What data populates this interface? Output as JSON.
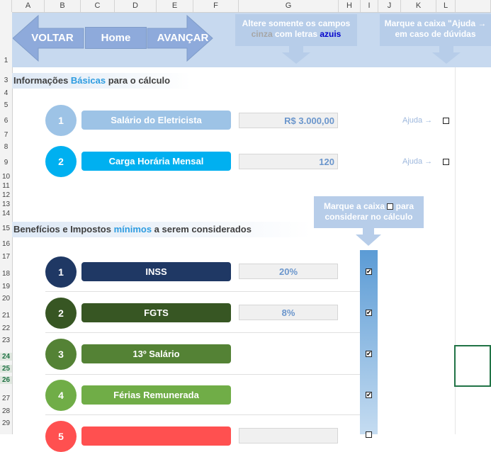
{
  "columns": [
    "A",
    "B",
    "C",
    "D",
    "E",
    "F",
    "G",
    "H",
    "I",
    "J",
    "K",
    "L"
  ],
  "rows": [
    "1",
    "3",
    "4",
    "5",
    "6",
    "7",
    "8",
    "9",
    "10",
    "11",
    "12",
    "13",
    "14",
    "15",
    "16",
    "17",
    "18",
    "19",
    "20",
    "21",
    "22",
    "23",
    "24",
    "25",
    "26",
    "27",
    "28",
    "29"
  ],
  "nav": {
    "back_label": "VOLTAR",
    "home_label": "Home",
    "next_label": "AVANÇAR"
  },
  "hints": {
    "fields_part1": "Altere somente os campos",
    "fields_gray": "cinza",
    "fields_mid": " com letras ",
    "fields_blue": "azuis",
    "help_line1": "Marque a caixa \"Ajuda →",
    "help_line2": "em caso de dúvidas",
    "consider_line1a": "Marque a caixa ",
    "consider_line1b": " para",
    "consider_line2": "considerar no cálculo"
  },
  "section1": {
    "pre": "Informações ",
    "highlight": "Básicas",
    "post": " para o cálculo"
  },
  "section2": {
    "pre": "Benefícios e Impostos ",
    "highlight": "mínimos",
    "post": " a serem considerados"
  },
  "basic_items": [
    {
      "num": "1",
      "label": "Salário do Eletricista",
      "value": "R$ 3.000,00",
      "help": "Ajuda →",
      "checked": false
    },
    {
      "num": "2",
      "label": "Carga Horária Mensal",
      "value": "120",
      "help": "Ajuda →",
      "checked": false
    }
  ],
  "benefit_items": [
    {
      "num": "1",
      "label": "INSS",
      "value": "20%",
      "checked": true
    },
    {
      "num": "2",
      "label": "FGTS",
      "value": "8%",
      "checked": true
    },
    {
      "num": "3",
      "label": "13º Salário",
      "value": "",
      "checked": true
    },
    {
      "num": "4",
      "label": "Férias Remunerada",
      "value": "",
      "checked": true
    },
    {
      "num": "5",
      "label": "",
      "value": "",
      "checked": false
    }
  ],
  "colors": {
    "banner": "#c7d9ef",
    "nav_button": "#8eaadb",
    "section_highlight": "#2e9ce0",
    "basic1": "#9dc3e6",
    "basic2": "#00b0f0",
    "inss": "#1f3864",
    "fgts": "#375623",
    "decimo": "#548235",
    "ferias": "#70ad47",
    "item5": "#ff5050",
    "value_text": "#6b96cc"
  }
}
